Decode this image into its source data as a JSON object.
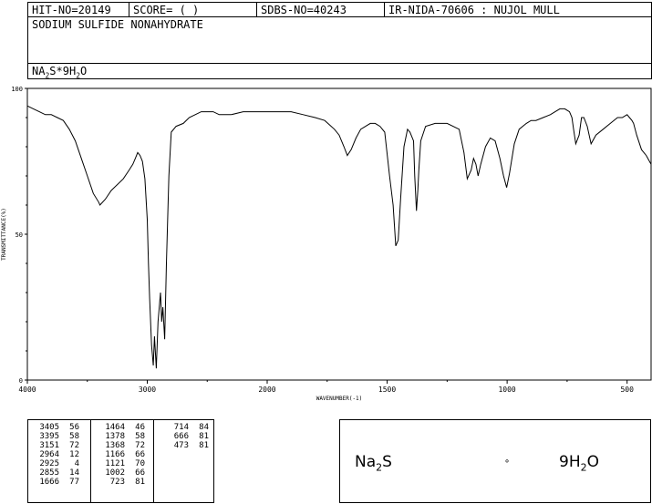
{
  "header": {
    "hit_no": "HIT-NO=20149",
    "score": "SCORE=  (   )",
    "sdbs_no": "SDBS-NO=40243",
    "ir_code": "IR-NIDA-70606 : NUJOL MULL",
    "compound_name": "SODIUM SULFIDE NONAHYDRATE",
    "formula_main": "NA",
    "formula_sub1": "2",
    "formula_mid": "S*9H",
    "formula_sub2": "2",
    "formula_end": "O"
  },
  "chart_data": {
    "type": "line",
    "xlabel": "WAVENUMBER(-1)",
    "ylabel": "TRANSMITTANCE(%)",
    "xlim": [
      4000,
      400
    ],
    "ylim": [
      0,
      100
    ],
    "x_ticks": [
      "4000",
      "3000",
      "2000",
      "1500",
      "1000",
      "500"
    ],
    "x_tick_values": [
      4000,
      3000,
      2000,
      1500,
      1000,
      500
    ],
    "y_ticks": [
      "100",
      "50",
      "0"
    ],
    "y_tick_values": [
      100,
      50,
      0
    ],
    "series": [
      {
        "x": [
          4000,
          3950,
          3900,
          3850,
          3800,
          3750,
          3700,
          3650,
          3600,
          3550,
          3500,
          3450,
          3405,
          3395,
          3350,
          3300,
          3250,
          3200,
          3151,
          3120,
          3100,
          3080,
          3060,
          3040,
          3020,
          3000,
          2990,
          2980,
          2964,
          2950,
          2940,
          2925,
          2910,
          2890,
          2880,
          2870,
          2855,
          2840,
          2820,
          2800,
          2760,
          2700,
          2650,
          2600,
          2550,
          2500,
          2450,
          2400,
          2300,
          2200,
          2100,
          2000,
          1950,
          1900,
          1850,
          1800,
          1760,
          1720,
          1700,
          1680,
          1666,
          1650,
          1630,
          1610,
          1590,
          1570,
          1550,
          1530,
          1510,
          1490,
          1475,
          1464,
          1454,
          1444,
          1430,
          1415,
          1405,
          1390,
          1385,
          1378,
          1372,
          1368,
          1360,
          1340,
          1300,
          1250,
          1200,
          1180,
          1166,
          1150,
          1140,
          1130,
          1121,
          1110,
          1090,
          1070,
          1050,
          1030,
          1015,
          1002,
          990,
          970,
          950,
          920,
          900,
          880,
          850,
          820,
          800,
          780,
          760,
          740,
          730,
          723,
          714,
          700,
          690,
          680,
          666,
          650,
          630,
          600,
          570,
          540,
          520,
          500,
          490,
          480,
          473,
          460,
          440,
          420,
          400
        ],
        "y": [
          94,
          93,
          92,
          91,
          91,
          90,
          89,
          86,
          82,
          76,
          70,
          64,
          61,
          60,
          62,
          65,
          67,
          69,
          72,
          74,
          76,
          78,
          77,
          75,
          69,
          55,
          40,
          28,
          12,
          5,
          15,
          4,
          20,
          30,
          20,
          25,
          14,
          40,
          70,
          85,
          87,
          88,
          90,
          91,
          92,
          92,
          92,
          91,
          91,
          92,
          92,
          92,
          92,
          92,
          91,
          90,
          89,
          86,
          84,
          80,
          77,
          79,
          83,
          86,
          87,
          88,
          88,
          87,
          85,
          70,
          60,
          46,
          48,
          62,
          80,
          86,
          85,
          82,
          70,
          58,
          65,
          72,
          82,
          87,
          88,
          88,
          86,
          78,
          69,
          72,
          76,
          74,
          70,
          74,
          80,
          83,
          82,
          76,
          70,
          66,
          71,
          81,
          86,
          88,
          89,
          89,
          90,
          91,
          92,
          93,
          93,
          92,
          90,
          86,
          81,
          84,
          90,
          90,
          87,
          81,
          84,
          86,
          88,
          90,
          90,
          91,
          90,
          89,
          88,
          84,
          79,
          77,
          74
        ]
      }
    ]
  },
  "peak_table": {
    "col1": [
      {
        "wn": "3405",
        "t": "56"
      },
      {
        "wn": "3395",
        "t": "58"
      },
      {
        "wn": "3151",
        "t": "72"
      },
      {
        "wn": "2964",
        "t": "12"
      },
      {
        "wn": "2925",
        "t": "4"
      },
      {
        "wn": "2855",
        "t": "14"
      },
      {
        "wn": "1666",
        "t": "77"
      }
    ],
    "col2": [
      {
        "wn": "1464",
        "t": "46"
      },
      {
        "wn": "1378",
        "t": "58"
      },
      {
        "wn": "1368",
        "t": "72"
      },
      {
        "wn": "1166",
        "t": "66"
      },
      {
        "wn": "1121",
        "t": "70"
      },
      {
        "wn": "1002",
        "t": "66"
      },
      {
        "wn": "723",
        "t": "81"
      }
    ],
    "col3": [
      {
        "wn": "714",
        "t": "84"
      },
      {
        "wn": "666",
        "t": "81"
      },
      {
        "wn": "473",
        "t": "81"
      }
    ]
  },
  "structure": {
    "left": "Na",
    "left_sub": "2",
    "left_end": "S",
    "dot": "∘",
    "right": "9H",
    "right_sub": "2",
    "right_end": "O"
  }
}
